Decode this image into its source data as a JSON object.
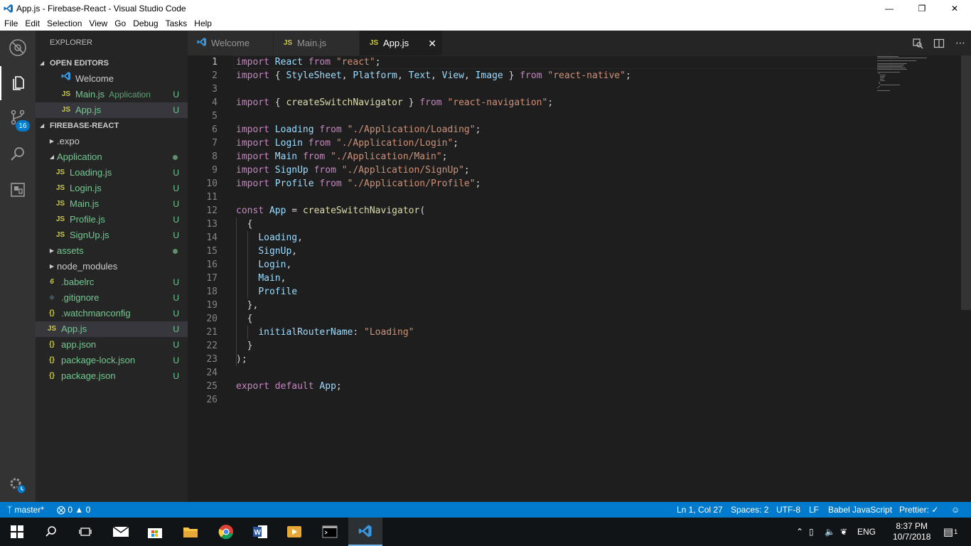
{
  "window": {
    "title": "App.js - Firebase-React - Visual Studio Code"
  },
  "menu": [
    "File",
    "Edit",
    "Selection",
    "View",
    "Go",
    "Debug",
    "Tasks",
    "Help"
  ],
  "activity": {
    "scm_badge": "16"
  },
  "sidebar": {
    "title": "EXPLORER",
    "open_editors_label": "OPEN EDITORS",
    "open_editors": [
      {
        "label": "Welcome",
        "hint": "",
        "status": ""
      },
      {
        "label": "Main.js",
        "hint": "Application",
        "status": "U"
      },
      {
        "label": "App.js",
        "hint": "",
        "status": "U"
      }
    ],
    "project_label": "FIREBASE-REACT",
    "tree": [
      {
        "label": ".expo",
        "status": ""
      },
      {
        "label": "Application",
        "status": ""
      },
      {
        "label": "Loading.js",
        "status": "U"
      },
      {
        "label": "Login.js",
        "status": "U"
      },
      {
        "label": "Main.js",
        "status": "U"
      },
      {
        "label": "Profile.js",
        "status": "U"
      },
      {
        "label": "SignUp.js",
        "status": "U"
      },
      {
        "label": "assets",
        "status": ""
      },
      {
        "label": "node_modules",
        "status": ""
      },
      {
        "label": ".babelrc",
        "status": "U"
      },
      {
        "label": ".gitignore",
        "status": "U"
      },
      {
        "label": ".watchmanconfig",
        "status": "U"
      },
      {
        "label": "App.js",
        "status": "U"
      },
      {
        "label": "app.json",
        "status": "U"
      },
      {
        "label": "package-lock.json",
        "status": "U"
      },
      {
        "label": "package.json",
        "status": "U"
      }
    ]
  },
  "tabs": [
    {
      "label": "Welcome"
    },
    {
      "label": "Main.js"
    },
    {
      "label": "App.js"
    }
  ],
  "editor": {
    "lines": [
      {
        "n": "1",
        "text": "import React from \"react\";"
      },
      {
        "n": "2",
        "text": "import { StyleSheet, Platform, Text, View, Image } from \"react-native\";"
      },
      {
        "n": "3",
        "text": ""
      },
      {
        "n": "4",
        "text": "import { createSwitchNavigator } from \"react-navigation\";"
      },
      {
        "n": "5",
        "text": ""
      },
      {
        "n": "6",
        "text": "import Loading from \"./Application/Loading\";"
      },
      {
        "n": "7",
        "text": "import Login from \"./Application/Login\";"
      },
      {
        "n": "8",
        "text": "import Main from \"./Application/Main\";"
      },
      {
        "n": "9",
        "text": "import SignUp from \"./Application/SignUp\";"
      },
      {
        "n": "10",
        "text": "import Profile from \"./Application/Profile\";"
      },
      {
        "n": "11",
        "text": ""
      },
      {
        "n": "12",
        "text": "const App = createSwitchNavigator("
      },
      {
        "n": "13",
        "text": "  {"
      },
      {
        "n": "14",
        "text": "    Loading,"
      },
      {
        "n": "15",
        "text": "    SignUp,"
      },
      {
        "n": "16",
        "text": "    Login,"
      },
      {
        "n": "17",
        "text": "    Main,"
      },
      {
        "n": "18",
        "text": "    Profile"
      },
      {
        "n": "19",
        "text": "  },"
      },
      {
        "n": "20",
        "text": "  {"
      },
      {
        "n": "21",
        "text": "    initialRouterName: \"Loading\""
      },
      {
        "n": "22",
        "text": "  }"
      },
      {
        "n": "23",
        "text": ");"
      },
      {
        "n": "24",
        "text": ""
      },
      {
        "n": "25",
        "text": "export default App;"
      },
      {
        "n": "26",
        "text": ""
      }
    ]
  },
  "status": {
    "branch": "master*",
    "errors": "0",
    "warnings": "0",
    "position": "Ln 1, Col 27",
    "spaces": "Spaces: 2",
    "encoding": "UTF-8",
    "eol": "LF",
    "language": "Babel JavaScript",
    "formatter": "Prettier: ✓"
  },
  "taskbar": {
    "language": "ENG",
    "time": "8:37 PM",
    "date": "10/7/2018",
    "notifications": "1"
  },
  "colors": {
    "keyword": "#c586c0",
    "string": "#ce9178",
    "variable": "#9cdcfe",
    "function": "#dcdcaa",
    "plain": "#d4d4d4",
    "accent": "#007acc",
    "git_untracked": "#73c991"
  }
}
